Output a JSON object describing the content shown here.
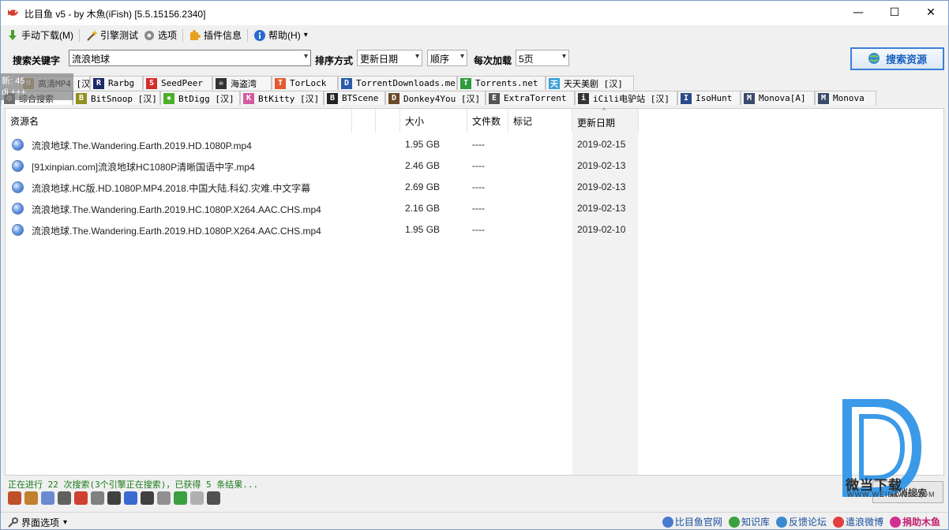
{
  "window": {
    "title": "比目鱼 v5 - by 木魚(iFish) [5.5.15156.2340]",
    "minimize": "—",
    "maximize": "☐",
    "close": "✕"
  },
  "toolbar": {
    "manual_download": "手动下载(M)",
    "engine_test": "引擎测试",
    "options": "选项",
    "plugin_info": "插件信息",
    "help": "帮助(H)",
    "help_arrow": "▾"
  },
  "search": {
    "keyword_label": "搜索关键字",
    "keyword_value": "流浪地球",
    "sort_label": "排序方式",
    "sort_value": "更新日期",
    "order_value": "顺序",
    "load_label": "每次加载",
    "load_value": "5页",
    "search_button": "搜索资源"
  },
  "overlay": {
    "line1": "新: 45",
    "line2": "di +++"
  },
  "engine_tabs_row1": [
    {
      "label": "高清MP4 [汉]",
      "icon": "hd-icon",
      "color": "#c0a060",
      "glyph": "H"
    },
    {
      "label": "Rarbg",
      "icon": "rarbg-icon",
      "color": "#1b2a6b",
      "glyph": "R"
    },
    {
      "label": "SeedPeer",
      "icon": "seedpeer-icon",
      "color": "#d62b2b",
      "glyph": "S"
    },
    {
      "label": "海盗湾",
      "icon": "pirate-icon",
      "color": "#333333",
      "glyph": "☠"
    },
    {
      "label": "TorLock",
      "icon": "torlock-icon",
      "color": "#e25b2c",
      "glyph": "T"
    },
    {
      "label": "TorrentDownloads.me",
      "icon": "torrentdownloads-icon",
      "color": "#2a5caa",
      "glyph": "D"
    },
    {
      "label": "Torrents.net",
      "icon": "torrentsnet-icon",
      "color": "#2e9b3e",
      "glyph": "T"
    },
    {
      "label": "天天美剧 [汉]",
      "icon": "ttmj-icon",
      "color": "#3aa0d8",
      "glyph": "天"
    }
  ],
  "engine_tabs_row2": [
    {
      "label": "综合搜索",
      "icon": "combined-icon",
      "color": "#6d6d6d",
      "glyph": "◎"
    },
    {
      "label": "BitSnoop [汉]",
      "icon": "bitsnoop-icon",
      "color": "#8f8f1f",
      "glyph": "B"
    },
    {
      "label": "BtDigg [汉]",
      "icon": "btdigg-icon",
      "color": "#4caf2a",
      "glyph": "✹"
    },
    {
      "label": "BtKitty [汉]",
      "icon": "btkitty-icon",
      "color": "#d45aa0",
      "glyph": "K"
    },
    {
      "label": "BTScene",
      "icon": "btscene-icon",
      "color": "#222222",
      "glyph": "B"
    },
    {
      "label": "Donkey4You [汉]",
      "icon": "donkey-icon",
      "color": "#6a4a2a",
      "glyph": "D"
    },
    {
      "label": "ExtraTorrent",
      "icon": "extratorrent-icon",
      "color": "#555555",
      "glyph": "E"
    },
    {
      "label": "iCili电驴站 [汉]",
      "icon": "icili-icon",
      "color": "#333333",
      "glyph": "i"
    },
    {
      "label": "IsoHunt",
      "icon": "isohunt-icon",
      "color": "#2a4a8a",
      "glyph": "I"
    },
    {
      "label": "Monova[A]",
      "icon": "monova-a-icon",
      "color": "#3a4a6a",
      "glyph": "M"
    },
    {
      "label": "Monova",
      "icon": "monova-icon",
      "color": "#3a4a6a",
      "glyph": "M"
    }
  ],
  "columns": {
    "name": "资源名",
    "size": "大小",
    "files": "文件数",
    "mark": "标记",
    "date": "更新日期",
    "sort_indicator": "^"
  },
  "results": [
    {
      "name": "流浪地球.The.Wandering.Earth.2019.HD.1080P.mp4",
      "size": "1.95 GB",
      "files": "----",
      "date": "2019-02-15"
    },
    {
      "name": "[91xinpian.com]流浪地球HC1080P清晰国语中字.mp4",
      "size": "2.46 GB",
      "files": "----",
      "date": "2019-02-13"
    },
    {
      "name": "流浪地球.HC版.HD.1080P.MP4.2018.中国大陆.科幻.灾难.中文字幕",
      "size": "2.69 GB",
      "files": "----",
      "date": "2019-02-13"
    },
    {
      "name": "流浪地球.The.Wandering.Earth.2019.HC.1080P.X264.AAC.CHS.mp4",
      "size": "2.16 GB",
      "files": "----",
      "date": "2019-02-13"
    },
    {
      "name": "流浪地球.The.Wandering.Earth.2019.HD.1080P.X264.AAC.CHS.mp4",
      "size": "1.95 GB",
      "files": "----",
      "date": "2019-02-10"
    }
  ],
  "status": {
    "text": "正在进行 22 次搜索(3个引擎正在搜索)，已获得 5 条结果...",
    "cancel_button": "取消搜索"
  },
  "status_icons": [
    "#c0502a",
    "#c08030",
    "#6a8ad0",
    "#606060",
    "#d04030",
    "#808080",
    "#404040",
    "#3a6ad0",
    "#404040",
    "#909090",
    "#3aa040",
    "#b0b0b0",
    "#505050"
  ],
  "bottom": {
    "ui_options": "界面选项",
    "ui_arrow": "▾",
    "links": [
      {
        "label": "比目鱼官网",
        "color": "#4a7ad0"
      },
      {
        "label": "知识库",
        "color": "#3aa040"
      },
      {
        "label": "反馈论坛",
        "color": "#3a8ad0"
      },
      {
        "label": "遣浪微博",
        "color": "#e04040"
      },
      {
        "label": "捐助木鱼",
        "color": "#d03090"
      }
    ]
  },
  "watermark": {
    "brand": "微当下载",
    "url": "WWW.WEIDOWN.COM"
  }
}
